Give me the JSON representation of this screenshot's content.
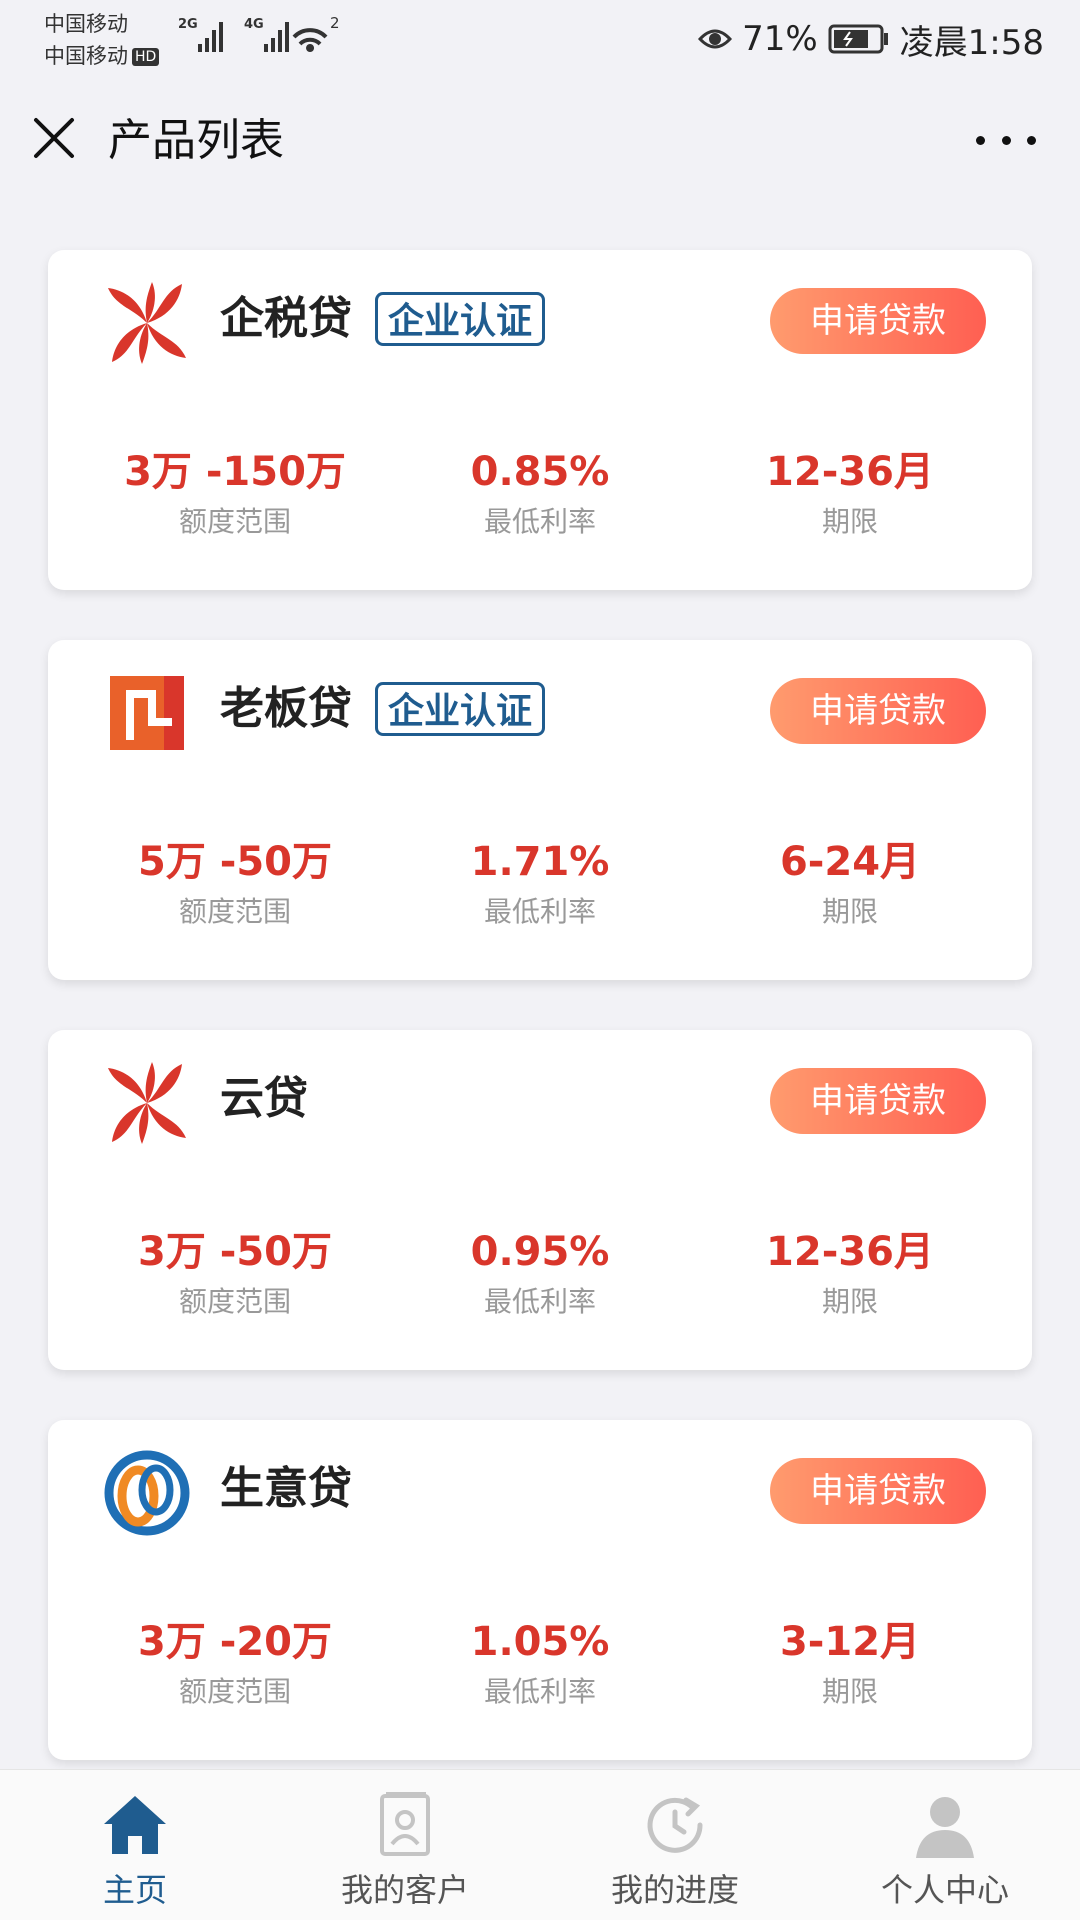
{
  "status_bar": {
    "carrier_1": "中国移动",
    "carrier_2": "中国移动",
    "hd": "HD",
    "net_1": "2G",
    "net_2": "4G",
    "wifi_count": "2",
    "battery": "71%",
    "time": "凌晨1:58"
  },
  "header": {
    "title": "产品列表"
  },
  "apply_label": "申请贷款",
  "cert_label": "企业认证",
  "stat_labels": {
    "amount": "额度范围",
    "rate": "最低利率",
    "term": "期限"
  },
  "products": [
    {
      "name": "企税贷",
      "amount": "3万 -150万",
      "rate": "0.85%",
      "term": "12-36月"
    },
    {
      "name": "老板贷",
      "amount": "5万 -50万",
      "rate": "1.71%",
      "term": "6-24月"
    },
    {
      "name": "云贷",
      "amount": "3万 -50万",
      "rate": "0.95%",
      "term": "12-36月"
    },
    {
      "name": "生意贷",
      "amount": "3万 -20万",
      "rate": "1.05%",
      "term": "3-12月"
    }
  ],
  "nav": {
    "home": "主页",
    "customers": "我的客户",
    "progress": "我的进度",
    "profile": "个人中心"
  },
  "colors": {
    "accent_red": "#d9362b",
    "brand_blue": "#1f5c8f",
    "apply_gradient_start": "#ff9b6e",
    "apply_gradient_end": "#ff5f52"
  }
}
